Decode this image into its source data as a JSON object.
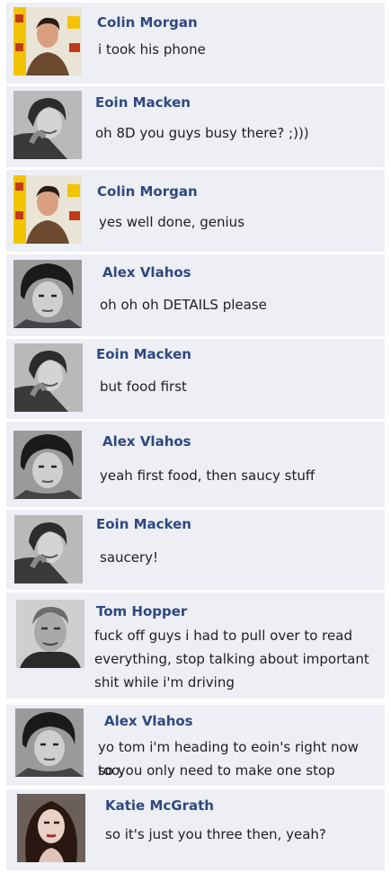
{
  "messages": [
    {
      "name": "Colin Morgan",
      "avatar": "colin-morgan-avatar",
      "text": [
        "i took his phone"
      ]
    },
    {
      "name": "Eoin Macken",
      "avatar": "eoin-macken-avatar",
      "text": [
        "oh 8D you guys busy there? ;)))"
      ]
    },
    {
      "name": "Colin Morgan",
      "avatar": "colin-morgan-avatar",
      "text": [
        "yes well done, genius"
      ]
    },
    {
      "name": "Alex Vlahos",
      "avatar": "alex-vlahos-avatar",
      "text": [
        "oh oh oh DETAILS please"
      ]
    },
    {
      "name": "Eoin Macken",
      "avatar": "eoin-macken-avatar",
      "text": [
        "but food first"
      ]
    },
    {
      "name": "Alex Vlahos",
      "avatar": "alex-vlahos-avatar",
      "text": [
        "yeah first food, then saucy stuff"
      ]
    },
    {
      "name": "Eoin Macken",
      "avatar": "eoin-macken-avatar",
      "text": [
        "saucery!"
      ]
    },
    {
      "name": "Tom Hopper",
      "avatar": "tom-hopper-avatar",
      "text": [
        "fuck off guys i had to pull over to read",
        "everything, stop talking about important",
        "shit while i'm driving"
      ]
    },
    {
      "name": "Alex Vlahos",
      "avatar": "alex-vlahos-avatar",
      "text": [
        "yo tom i'm heading to eoin's right now too,",
        "so you only need to make one stop"
      ]
    },
    {
      "name": "Katie McGrath",
      "avatar": "katie-mcgrath-avatar",
      "text": [
        "so it's just you three then, yeah?"
      ]
    }
  ]
}
